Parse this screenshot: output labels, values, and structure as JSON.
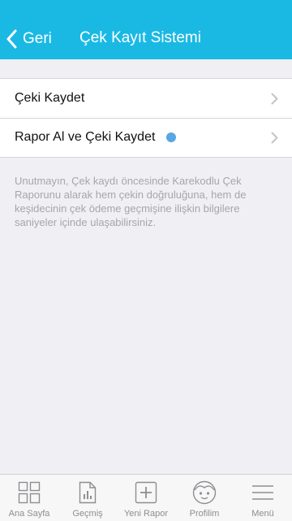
{
  "header": {
    "back_label": "Geri",
    "title": "Çek Kayıt Sistemi",
    "color": "#1ab9e4"
  },
  "list": {
    "items": [
      {
        "label": "Çeki Kaydet",
        "icon": "chevron-right-icon",
        "has_badge": false
      },
      {
        "label": "Rapor Al ve Çeki Kaydet",
        "icon": "chevron-right-icon",
        "has_badge": true,
        "badge_color": "#5aa6e2"
      }
    ]
  },
  "note": "Unutmayın, Çek kaydı öncesinde Karekodlu Çek Raporunu alarak hem çekin doğruluğuna, hem de keşidecinin çek ödeme geçmişine ilişkin bilgilere saniyeler içinde ulaşabilirsiniz.",
  "tabbar": {
    "tabs": [
      {
        "label": "Ana Sayfa",
        "icon": "grid-icon"
      },
      {
        "label": "Geçmiş",
        "icon": "report-chart-icon"
      },
      {
        "label": "Yeni Rapor",
        "icon": "plus-square-icon"
      },
      {
        "label": "Profilim",
        "icon": "face-icon"
      },
      {
        "label": "Menü",
        "icon": "hamburger-menu-icon"
      }
    ]
  }
}
